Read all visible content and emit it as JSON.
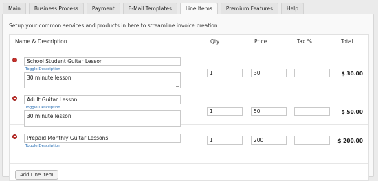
{
  "tabs": [
    {
      "label": "Main",
      "active": false
    },
    {
      "label": "Business Process",
      "active": false
    },
    {
      "label": "Payment",
      "active": false
    },
    {
      "label": "E-Mail Templates",
      "active": false
    },
    {
      "label": "Line Items",
      "active": true
    },
    {
      "label": "Premium Features",
      "active": false
    },
    {
      "label": "Help",
      "active": false
    }
  ],
  "intro_text": "Setup your common services and products in here to streamline invoice creation.",
  "columns": {
    "name": "Name & Description",
    "qty": "Qty.",
    "price": "Price",
    "tax": "Tax %",
    "total": "Total"
  },
  "line_items": [
    {
      "name": "School Student Guitar Lesson",
      "toggle": "Toggle Description",
      "description": "30 minute lesson",
      "qty": "1",
      "price": "30",
      "tax": "",
      "total": "$ 30.00"
    },
    {
      "name": "Adult Guitar Lesson",
      "toggle": "Toggle Description",
      "description": "30 minute lesson",
      "qty": "1",
      "price": "50",
      "tax": "",
      "total": "$ 50.00"
    },
    {
      "name": "Prepaid Monthly Guitar Lessons",
      "toggle": "Toggle Description",
      "description": "",
      "qty": "1",
      "price": "200",
      "tax": "",
      "total": "$ 200.00"
    }
  ],
  "add_button": "Add Line Item",
  "colors": {
    "remove_icon": "#c9302c",
    "toggle_link": "#2a70b5",
    "panel_bg": "#f9f9f9"
  }
}
